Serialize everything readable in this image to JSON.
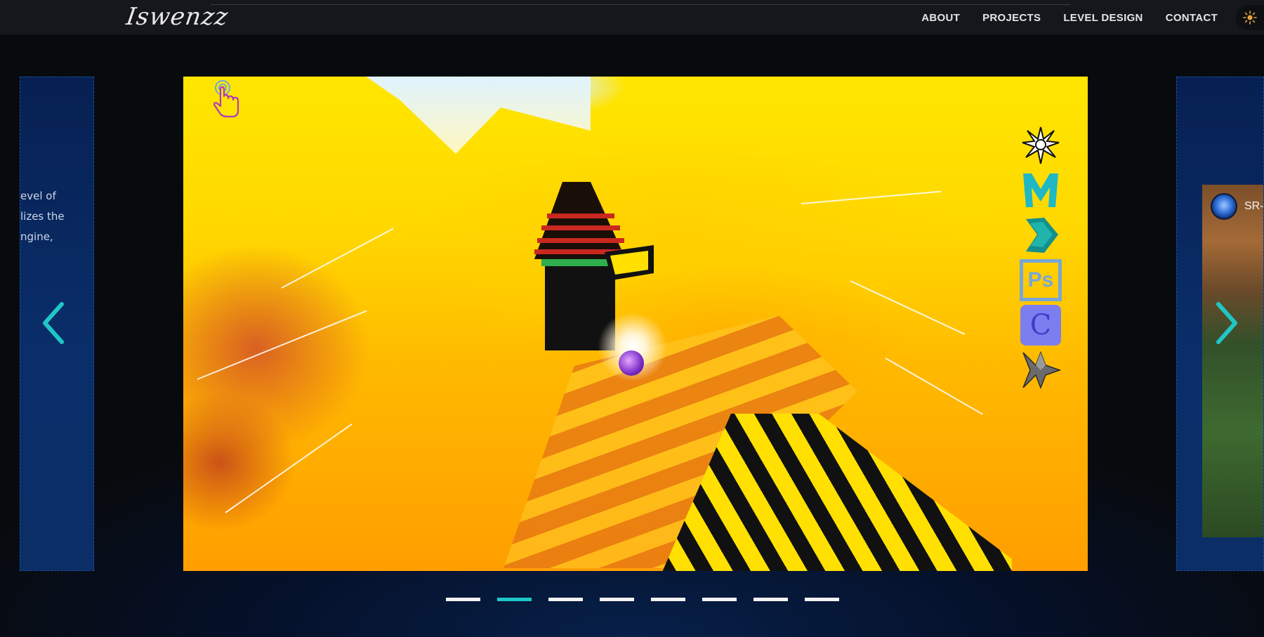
{
  "header": {
    "logo": "Iswenzz",
    "nav": [
      "ABOUT",
      "PROJECTS",
      "LEVEL DESIGN",
      "CONTACT"
    ]
  },
  "theme_toggle_icon": "sun-icon",
  "carousel": {
    "prev_slide_text": [
      "evel of",
      "lizes the",
      "ngine,"
    ],
    "next_slide_title": "SR-",
    "tool_icons": [
      "blender-icon",
      "maya-icon",
      "3dsmax-icon",
      "photoshop-icon",
      "c-language-icon",
      "unreal-icon"
    ],
    "photoshop_label": "Ps",
    "c_label": "C",
    "slide_count": 8,
    "active_slide_index": 1
  },
  "colors": {
    "accent": "#1fc6c6",
    "navbar": "#15171c",
    "side_card": "#0a2e6a",
    "dot_inactive": "#f2f2f2",
    "theme_sun": "#e8a63a"
  }
}
